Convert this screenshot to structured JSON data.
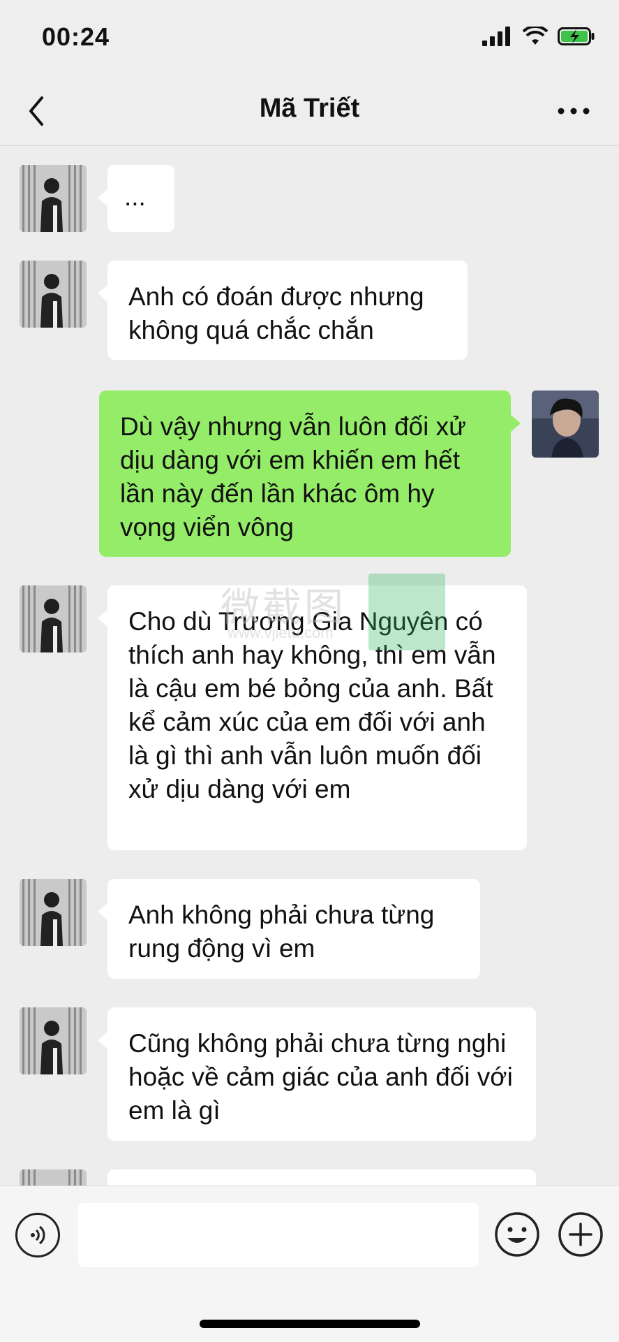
{
  "status_bar": {
    "time": "00:24"
  },
  "header": {
    "title": "Mã Triết"
  },
  "messages": [
    {
      "side": "in",
      "text": "..."
    },
    {
      "side": "in",
      "text": "Anh có đoán được nhưng không quá chắc chắn"
    },
    {
      "side": "out",
      "text": "Dù vậy nhưng vẫn luôn đối xử dịu dàng với em khiến em hết lần này đến lần khác ôm hy vọng viển vông"
    },
    {
      "side": "in",
      "text": "Cho dù Trương Gia Nguyên có thích anh hay không, thì em vẫn là cậu em bé bỏng của anh. Bất kể cảm xúc của em đối với anh là gì thì anh vẫn luôn muốn đối xử dịu dàng với em"
    },
    {
      "side": "in",
      "text": "Anh không phải chưa từng rung động vì em"
    },
    {
      "side": "in",
      "text": "Cũng không phải chưa từng nghi hoặc về cảm giác của anh đối với em là gì"
    },
    {
      "side": "in",
      "text": ""
    }
  ],
  "watermark": {
    "text": "微截图",
    "sub": "www.vjietu.com"
  },
  "input": {
    "value": "",
    "placeholder": ""
  },
  "icons": {
    "back": "chevron-left-icon",
    "more": "more-dots-icon",
    "voice": "voice-icon",
    "emoji": "emoji-icon",
    "plus": "plus-icon"
  },
  "colors": {
    "outgoing_bubble": "#95ec69",
    "incoming_bubble": "#ffffff",
    "background": "#ededed"
  }
}
